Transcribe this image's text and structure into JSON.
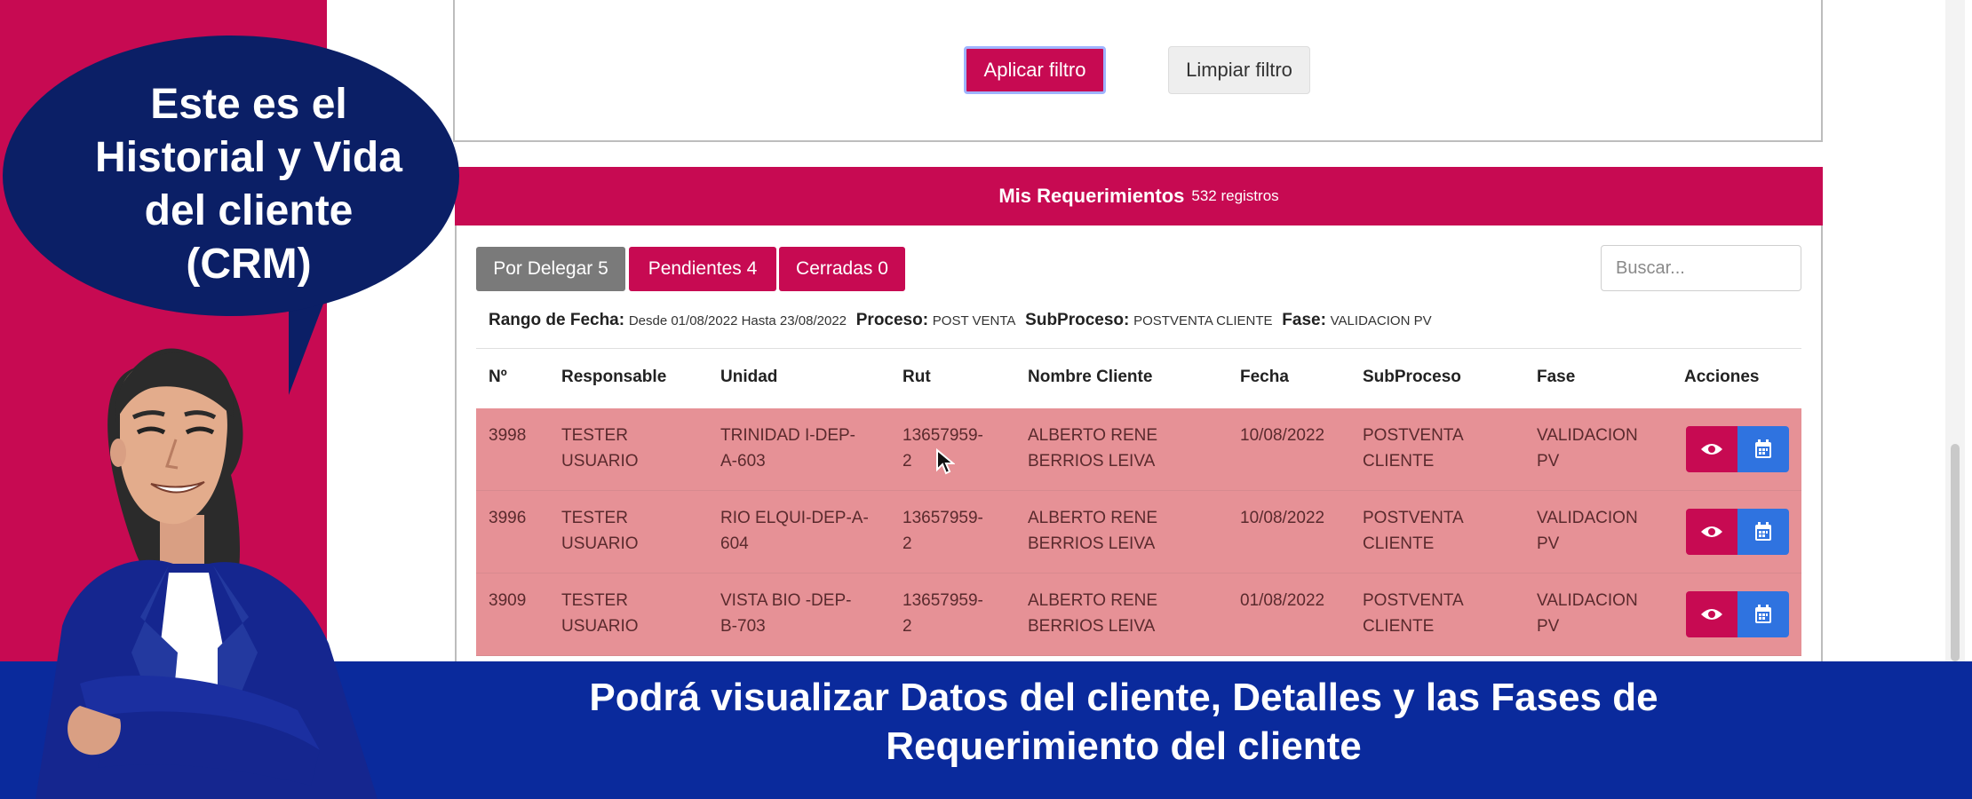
{
  "filter": {
    "apply_label": "Aplicar filtro",
    "clear_label": "Limpiar filtro"
  },
  "requirements": {
    "title": "Mis Requerimientos",
    "count": "532 registros",
    "tabs": [
      {
        "label": "Por Delegar 5"
      },
      {
        "label": "Pendientes 4"
      },
      {
        "label": "Cerradas 0"
      }
    ],
    "search_placeholder": "Buscar...",
    "summary": {
      "range_label": "Rango de Fecha:",
      "range_value": "Desde 01/08/2022 Hasta 23/08/2022",
      "process_label": "Proceso:",
      "process_value": "POST VENTA",
      "subprocess_label": "SubProceso:",
      "subprocess_value": "POSTVENTA CLIENTE",
      "phase_label": "Fase:",
      "phase_value": "VALIDACION PV"
    },
    "columns": [
      "Nº",
      "Responsable",
      "Unidad",
      "Rut",
      "Nombre Cliente",
      "Fecha",
      "SubProceso",
      "Fase",
      "Acciones"
    ],
    "rows": [
      {
        "n": "3998",
        "resp1": "TESTER",
        "resp2": "USUARIO",
        "unit1": "TRINIDAD I-DEP-",
        "unit2": "A-603",
        "rut1": "13657959-",
        "rut2": "2",
        "name1": "ALBERTO RENE",
        "name2": "BERRIOS LEIVA",
        "date": "10/08/2022",
        "sub1": "POSTVENTA",
        "sub2": "CLIENTE",
        "fase1": "VALIDACION",
        "fase2": "PV"
      },
      {
        "n": "3996",
        "resp1": "TESTER",
        "resp2": "USUARIO",
        "unit1": "RIO ELQUI-DEP-A-",
        "unit2": "604",
        "rut1": "13657959-",
        "rut2": "2",
        "name1": "ALBERTO RENE",
        "name2": "BERRIOS LEIVA",
        "date": "10/08/2022",
        "sub1": "POSTVENTA",
        "sub2": "CLIENTE",
        "fase1": "VALIDACION",
        "fase2": "PV"
      },
      {
        "n": "3909",
        "resp1": "TESTER",
        "resp2": "USUARIO",
        "unit1": "VISTA BIO -DEP-",
        "unit2": "B-703",
        "rut1": "13657959-",
        "rut2": "2",
        "name1": "ALBERTO RENE",
        "name2": "BERRIOS LEIVA",
        "date": "01/08/2022",
        "sub1": "POSTVENTA",
        "sub2": "CLIENTE",
        "fase1": "VALIDACION",
        "fase2": "PV"
      }
    ]
  },
  "bubble": {
    "lines": [
      "Este es el",
      "Historial y Vida",
      "del cliente",
      "(CRM)"
    ]
  },
  "banner": {
    "line1": "Podrá visualizar Datos del cliente, Detalles y las Fases de",
    "line2": "Requerimiento del cliente"
  },
  "icons": {
    "view": "eye-icon",
    "calendar": "calendar-icon",
    "cursor": "mouse-pointer-icon"
  },
  "colors": {
    "brand": "#c70a52",
    "row_bg": "#e69196",
    "calendar_btn": "#2f73e0",
    "banner": "#0a2a9c",
    "bubble": "#0b1f66"
  }
}
